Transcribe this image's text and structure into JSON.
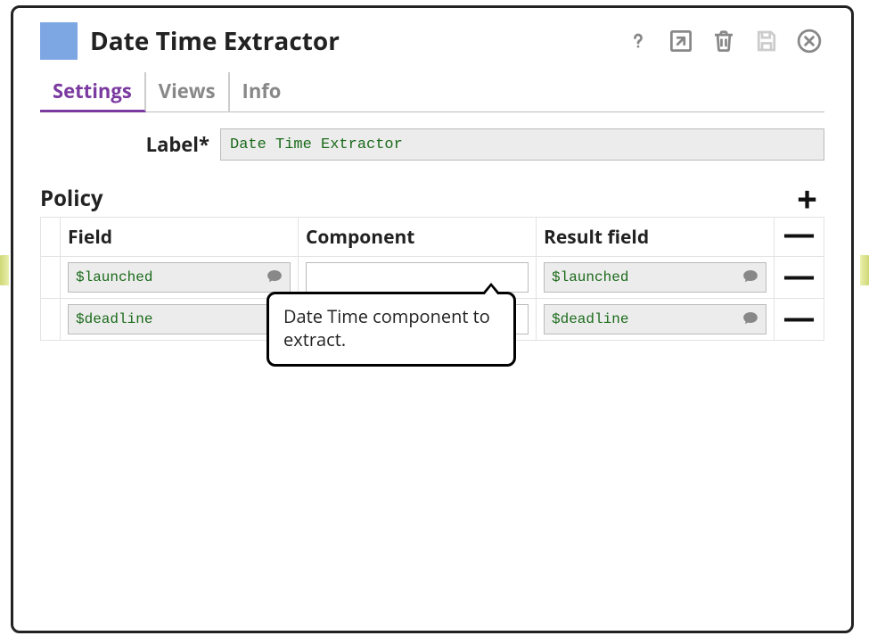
{
  "title": "Date Time Extractor",
  "swatch_color": "#7da7e3",
  "tabs": [
    {
      "label": "Settings",
      "active": true
    },
    {
      "label": "Views",
      "active": false
    },
    {
      "label": "Info",
      "active": false
    }
  ],
  "label_field": {
    "label": "Label*",
    "value": "Date Time Extractor"
  },
  "policy": {
    "heading": "Policy",
    "columns": {
      "field": "Field",
      "component": "Component",
      "result": "Result field"
    },
    "rows": [
      {
        "field": "$launched",
        "component": "",
        "result": "$launched"
      },
      {
        "field": "$deadline",
        "component": "",
        "result": "$deadline"
      }
    ]
  },
  "tooltip": "Date Time component to extract.",
  "icons": {
    "help": "help-icon",
    "export": "export-icon",
    "delete": "trash-icon",
    "save": "save-icon",
    "close": "close-icon",
    "add": "+",
    "remove": "—",
    "comment": "comment-icon"
  }
}
